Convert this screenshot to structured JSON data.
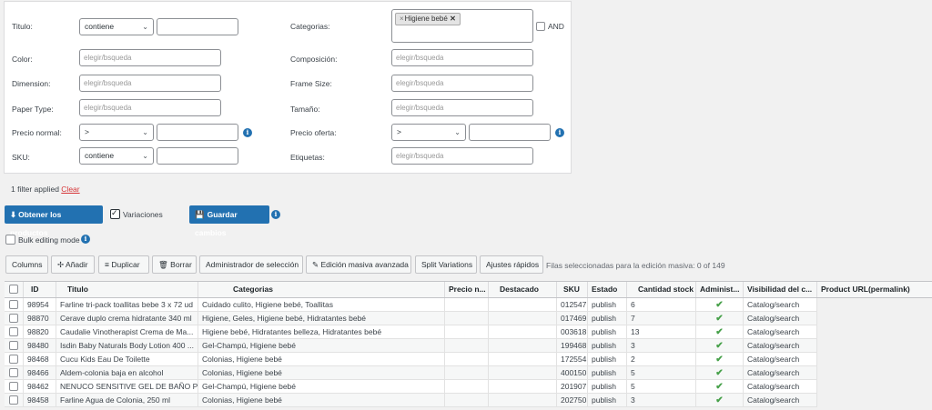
{
  "filters": {
    "titulo": {
      "label": "Titulo",
      "operator": "contiene",
      "value": ""
    },
    "categorias": {
      "label": "Categorias",
      "tag": "Higiene bebé",
      "and_label": "AND"
    },
    "color": {
      "label": "Color",
      "placeholder": "elegir/bsqueda"
    },
    "composicion": {
      "label": "Composición",
      "placeholder": "elegir/bsqueda"
    },
    "dimension": {
      "label": "Dimension",
      "placeholder": "elegir/bsqueda"
    },
    "frame_size": {
      "label": "Frame Size",
      "placeholder": "elegir/bsqueda"
    },
    "paper_type": {
      "label": "Paper Type",
      "placeholder": "elegir/bsqueda"
    },
    "tamano": {
      "label": "Tamaño",
      "placeholder": "elegir/bsqueda"
    },
    "precio_normal": {
      "label": "Precio normal",
      "operator": ">"
    },
    "precio_oferta": {
      "label": "Precio oferta",
      "operator": ">"
    },
    "sku": {
      "label": "SKU",
      "operator": "contiene"
    },
    "etiquetas": {
      "label": "Etiquetas",
      "placeholder": "elegir/bsqueda"
    }
  },
  "applied": {
    "text": "1 filter applied",
    "clear": "Clear"
  },
  "actions": {
    "obtener": "Obtener los productos",
    "variaciones": "Variaciones",
    "guardar": "Guardar cambios",
    "bulk_mode": "Bulk editing mode"
  },
  "toolbar": {
    "columns": "Columns",
    "anadir": "Añadir",
    "duplicar": "Duplicar",
    "borrar": "Borrar",
    "admin_seleccion": "Administrador de selección",
    "edicion_masiva": "Edición masiva avanzada",
    "split": "Split Variations",
    "ajustes": "Ajustes rápidos",
    "selected_info": "Filas seleccionadas para la edición masiva:  0 of 149"
  },
  "table": {
    "headers": [
      "ID",
      "Titulo",
      "Categorias",
      "Precio n...",
      "Destacado",
      "SKU",
      "Estado",
      "Cantidad stock",
      "Administ...",
      "Visibilidad del c...",
      "Product URL(permalink)"
    ],
    "rows": [
      [
        "98954",
        "Farline tri-pack toallitas bebe 3 x 72 ud",
        "Cuidado culito, Higiene bebé, Toallitas",
        "",
        "",
        "012547",
        "publish",
        "6",
        "✔",
        "Catalog/search"
      ],
      [
        "98870",
        "Cerave duplo crema hidratante 340 ml",
        "Higiene, Geles, Higiene bebé, Hidratantes bebé",
        "",
        "",
        "017469",
        "publish",
        "7",
        "✔",
        "Catalog/search"
      ],
      [
        "98820",
        "Caudalie Vinotherapist Crema de Ma...",
        "Higiene bebé, Hidratantes belleza, Hidratantes bebé",
        "",
        "",
        "003618",
        "publish",
        "13",
        "✔",
        "Catalog/search"
      ],
      [
        "98480",
        "Isdin Baby Naturals Body Lotion 400 ...",
        "Gel-Champú, Higiene bebé",
        "",
        "",
        "199468",
        "publish",
        "3",
        "✔",
        "Catalog/search"
      ],
      [
        "98468",
        "Cucu Kids Eau De Toilette",
        "Colonias, Higiene bebé",
        "",
        "",
        "172554",
        "publish",
        "2",
        "✔",
        "Catalog/search"
      ],
      [
        "98466",
        "Aldem-colonia baja en alcohol",
        "Colonias, Higiene bebé",
        "",
        "",
        "400150",
        "publish",
        "5",
        "✔",
        "Catalog/search"
      ],
      [
        "98462",
        "NENUCO SENSITIVE GEL DE BAÑO P...",
        "Gel-Champú, Higiene bebé",
        "",
        "",
        "201907",
        "publish",
        "5",
        "✔",
        "Catalog/search"
      ],
      [
        "98458",
        "Farline Agua de Colonia, 250 ml",
        "Colonias, Higiene bebé",
        "",
        "",
        "202750",
        "publish",
        "3",
        "✔",
        "Catalog/search"
      ]
    ]
  }
}
